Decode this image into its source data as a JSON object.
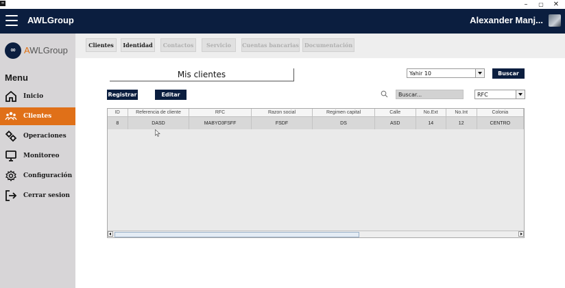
{
  "app": {
    "brand": "AWLGroup",
    "user_name": "Alexander Manj...",
    "logo_text_a": "A",
    "logo_text_rest": "WLGroup"
  },
  "window_controls": [
    "–",
    "▢",
    "✕"
  ],
  "sidebar": {
    "menu_title": "Menu",
    "items": [
      {
        "label": "Inicio",
        "icon": "home-icon",
        "active": false
      },
      {
        "label": "Clientes",
        "icon": "users-icon",
        "active": true
      },
      {
        "label": "Operaciones",
        "icon": "cogs-icon",
        "active": false
      },
      {
        "label": "Monitoreo",
        "icon": "monitor-icon",
        "active": false
      },
      {
        "label": "Configuración",
        "icon": "gear-icon",
        "active": false
      },
      {
        "label": "Cerrar sesion",
        "icon": "logout-icon",
        "active": false
      }
    ]
  },
  "tabs": [
    {
      "label": "Clientes",
      "enabled": true
    },
    {
      "label": "Identidad",
      "enabled": true
    },
    {
      "label": "Contactos",
      "enabled": false
    },
    {
      "label": "Servicio",
      "enabled": false
    },
    {
      "label": "Cuentas bancarias",
      "enabled": false
    },
    {
      "label": "Documentación",
      "enabled": false
    }
  ],
  "main": {
    "title": "Mis clientes",
    "user_select_value": "Yahir 10",
    "buscar_button": "Buscar",
    "registrar_button": "Registrar",
    "editar_button": "Editar",
    "search_placeholder": "Buscar...",
    "filter_select_value": "RFC"
  },
  "table": {
    "columns": [
      "ID",
      "Referencia de cliente",
      "RFC",
      "Razon social",
      "Regimen capital",
      "Calle",
      "No.Ext",
      "No.Int",
      "Colonia"
    ],
    "rows": [
      [
        "8",
        "DASD",
        "MABYO3FSFF",
        "FSDF",
        "DS",
        "ASD",
        "14",
        "12",
        "CENTRO"
      ]
    ]
  },
  "colors": {
    "navy": "#0b1e3f",
    "accent_orange": "#e07018",
    "sidebar_bg": "#d7d5d7"
  }
}
